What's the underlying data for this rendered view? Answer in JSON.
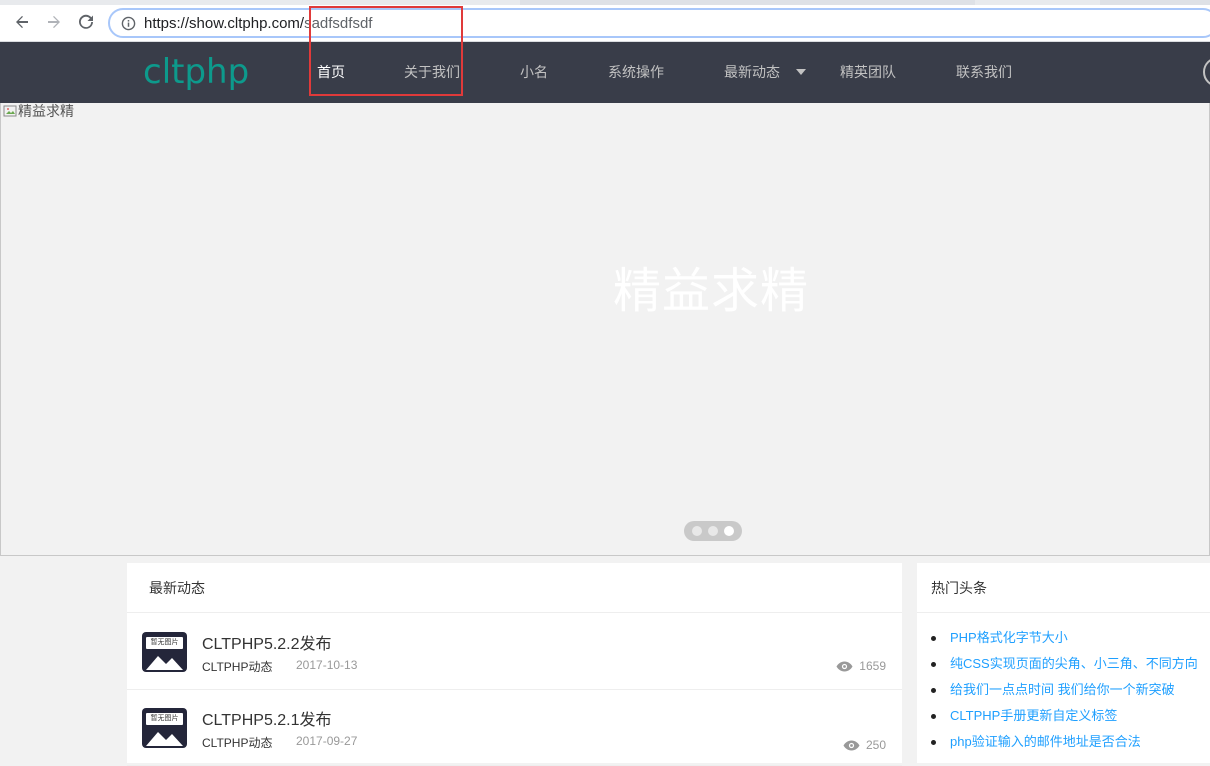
{
  "browser": {
    "url_host": "https://show.cltphp.com/",
    "url_path": "sadfsdfsdf"
  },
  "header": {
    "logo": "cltphp",
    "nav": [
      {
        "label": "首页",
        "active": true
      },
      {
        "label": "关于我们"
      },
      {
        "label": "小名"
      },
      {
        "label": "系统操作"
      },
      {
        "label": "最新动态",
        "has_dropdown": true
      },
      {
        "label": "精英团队"
      },
      {
        "label": "联系我们"
      }
    ]
  },
  "banner": {
    "broken_image_alt": "精益求精",
    "title": "精益求精",
    "dots": 3,
    "active_dot": 3
  },
  "news_panel": {
    "title": "最新动态",
    "thumb_label": "暂无图片",
    "items": [
      {
        "title": "CLTPHP5.2.2发布",
        "category": "CLTPHP动态",
        "date": "2017-10-13",
        "views": "1659"
      },
      {
        "title": "CLTPHP5.2.1发布",
        "category": "CLTPHP动态",
        "date": "2017-09-27",
        "views": "250"
      }
    ]
  },
  "hot_panel": {
    "title": "热门头条",
    "items": [
      "PHP格式化字节大小",
      "纯CSS实现页面的尖角、小三角、不同方向",
      "给我们一点点时间 我们给你一个新突破",
      "CLTPHP手册更新自定义标签",
      "php验证输入的邮件地址是否合法"
    ]
  },
  "colors": {
    "header_bg": "#393d49",
    "logo": "#0d9a8c",
    "link": "#1e9fff",
    "highlight": "#e03a3a"
  }
}
